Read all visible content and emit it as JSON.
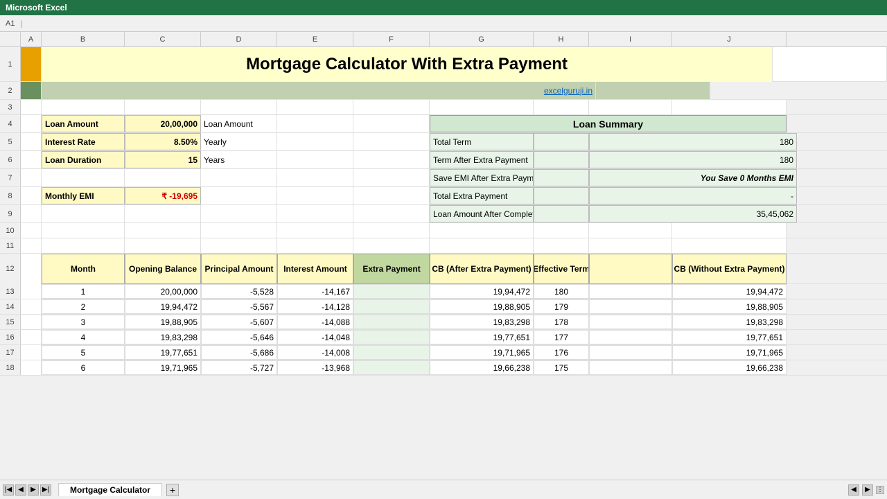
{
  "title": "Mortgage Calculator With Extra Payment",
  "website": "excelguruji.in",
  "inputs": {
    "loan_amount_label": "Loan Amount",
    "loan_amount_value": "20,00,000",
    "interest_rate_label": "Interest Rate",
    "interest_rate_value": "8.50%",
    "loan_duration_label": "Loan Duration",
    "loan_duration_value": "15",
    "monthly_emi_label": "Monthly EMI",
    "monthly_emi_value": "₹ -19,695"
  },
  "input_descs": {
    "loan_amount": "Loan Amount",
    "interest_rate": "Yearly",
    "loan_duration": "Years"
  },
  "loan_summary": {
    "title": "Loan Summary",
    "rows": [
      {
        "label": "Total Term",
        "value": "180"
      },
      {
        "label": "Term After Extra Payment",
        "value": "180"
      },
      {
        "label": "Save EMI After Extra Payment",
        "value": "You Save 0 Months EMI"
      },
      {
        "label": "Total Extra Payment",
        "value": "-"
      },
      {
        "label": "Loan Amount After Completion",
        "value": "35,45,062"
      }
    ]
  },
  "table": {
    "headers": [
      "Month",
      "Opening Balance",
      "Principal Amount",
      "Interest Amount",
      "Extra Payment",
      "CB (After Extra Payment)",
      "Effective Term",
      "CB (Without Extra Payment)"
    ],
    "rows": [
      {
        "month": "1",
        "opening": "20,00,000",
        "principal": "-5,528",
        "interest": "-14,167",
        "extra": "",
        "cb_after": "19,94,472",
        "eff_term": "180",
        "cb_without": "19,94,472"
      },
      {
        "month": "2",
        "opening": "19,94,472",
        "principal": "-5,567",
        "interest": "-14,128",
        "extra": "",
        "cb_after": "19,88,905",
        "eff_term": "179",
        "cb_without": "19,88,905"
      },
      {
        "month": "3",
        "opening": "19,88,905",
        "principal": "-5,607",
        "interest": "-14,088",
        "extra": "",
        "cb_after": "19,83,298",
        "eff_term": "178",
        "cb_without": "19,83,298"
      },
      {
        "month": "4",
        "opening": "19,83,298",
        "principal": "-5,646",
        "interest": "-14,048",
        "extra": "",
        "cb_after": "19,77,651",
        "eff_term": "177",
        "cb_without": "19,77,651"
      },
      {
        "month": "5",
        "opening": "19,77,651",
        "principal": "-5,686",
        "interest": "-14,008",
        "extra": "",
        "cb_after": "19,71,965",
        "eff_term": "176",
        "cb_without": "19,71,965"
      },
      {
        "month": "6",
        "opening": "19,71,965",
        "principal": "-5,727",
        "interest": "-13,968",
        "extra": "",
        "cb_after": "19,66,238",
        "eff_term": "175",
        "cb_without": "19,66,238"
      }
    ]
  },
  "sheet_tab": "Mortgage Calculator",
  "col_headers": [
    "A",
    "B",
    "C",
    "D",
    "E",
    "F",
    "G",
    "H",
    "I",
    "J"
  ]
}
